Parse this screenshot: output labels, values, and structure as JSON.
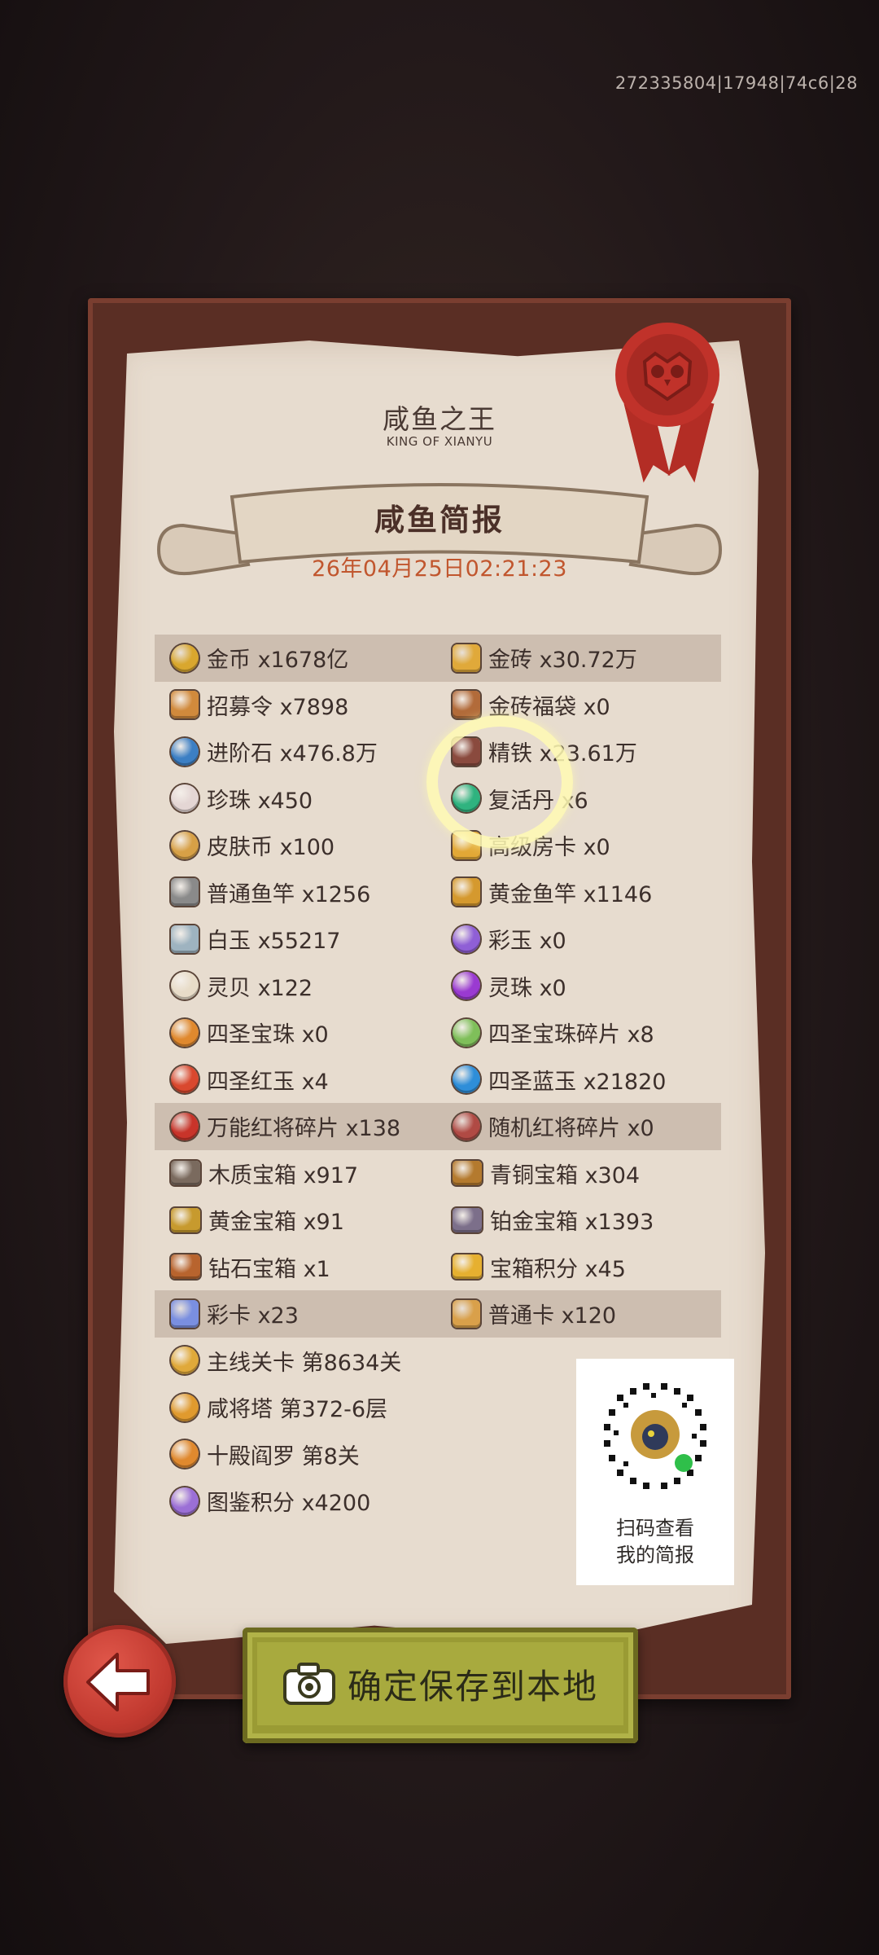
{
  "corner_id": "272335804|17948|74c6|28",
  "header": {
    "title": "咸鱼之王",
    "subtitle": "KING OF XIANYU"
  },
  "report": {
    "title": "咸鱼简报",
    "date": "26年04月25日02:21:23"
  },
  "rows": [
    {
      "shaded": true,
      "left": {
        "icon": "gold-coin-icon",
        "color": "#d9a72e",
        "text": "金币 x1678亿"
      },
      "right": {
        "icon": "gold-brick-icon",
        "color": "#e0a93a",
        "text": "金砖 x30.72万"
      }
    },
    {
      "shaded": false,
      "left": {
        "icon": "recruit-token-icon",
        "color": "#d18a3c",
        "text": "招募令 x7898"
      },
      "right": {
        "icon": "gold-brick-bag-icon",
        "color": "#b26b3a",
        "text": "金砖福袋 x0"
      }
    },
    {
      "shaded": false,
      "left": {
        "icon": "advance-stone-icon",
        "color": "#3c7fc4",
        "text": "进阶石 x476.8万"
      },
      "right": {
        "icon": "refined-iron-icon",
        "color": "#8a4a3e",
        "text": "精铁 x23.61万"
      }
    },
    {
      "shaded": false,
      "left": {
        "icon": "pearl-icon",
        "color": "#e4d6d4",
        "text": "珍珠 x450"
      },
      "right": {
        "icon": "revive-pill-icon",
        "color": "#2fb37f",
        "text": "复活丹 x6"
      }
    },
    {
      "shaded": false,
      "left": {
        "icon": "skin-coin-icon",
        "color": "#d7a046",
        "text": "皮肤币 x100"
      },
      "right": {
        "icon": "premium-room-card-icon",
        "color": "#e2a836",
        "text": "高级房卡 x0"
      }
    },
    {
      "shaded": false,
      "left": {
        "icon": "fishing-rod-icon",
        "color": "#8a8a8a",
        "text": "普通鱼竿 x1256"
      },
      "right": {
        "icon": "golden-fishing-rod-icon",
        "color": "#d5992e",
        "text": "黄金鱼竿 x1146"
      }
    },
    {
      "shaded": false,
      "left": {
        "icon": "white-jade-icon",
        "color": "#9eb3c0",
        "text": "白玉 x55217"
      },
      "right": {
        "icon": "color-jade-icon",
        "color": "#8f5fd6",
        "text": "彩玉 x0"
      }
    },
    {
      "shaded": false,
      "left": {
        "icon": "spirit-shell-icon",
        "color": "#e8dcc8",
        "text": "灵贝 x122"
      },
      "right": {
        "icon": "spirit-orb-icon",
        "color": "#9a3ad1",
        "text": "灵珠 x0"
      }
    },
    {
      "shaded": false,
      "left": {
        "icon": "four-saint-orb-icon",
        "color": "#e0892e",
        "text": "四圣宝珠 x0"
      },
      "right": {
        "icon": "four-saint-orb-shard-icon",
        "color": "#7fbf5a",
        "text": "四圣宝珠碎片 x8"
      }
    },
    {
      "shaded": false,
      "left": {
        "icon": "four-saint-red-jade-icon",
        "color": "#d9482e",
        "text": "四圣红玉 x4"
      },
      "right": {
        "icon": "four-saint-blue-jade-icon",
        "color": "#2e8ed9",
        "text": "四圣蓝玉 x21820"
      }
    },
    {
      "shaded": true,
      "left": {
        "icon": "universal-red-shard-icon",
        "color": "#c8342a",
        "text": "万能红将碎片 x138"
      },
      "right": {
        "icon": "random-red-shard-icon",
        "color": "#b04a44",
        "text": "随机红将碎片 x0"
      }
    },
    {
      "shaded": false,
      "left": {
        "icon": "wooden-chest-icon",
        "color": "#7a6a5e",
        "text": "木质宝箱 x917"
      },
      "right": {
        "icon": "bronze-chest-icon",
        "color": "#b47a2e",
        "text": "青铜宝箱 x304"
      }
    },
    {
      "shaded": false,
      "left": {
        "icon": "gold-chest-icon",
        "color": "#c79a2e",
        "text": "黄金宝箱 x91"
      },
      "right": {
        "icon": "platinum-chest-icon",
        "color": "#7c6f8a",
        "text": "铂金宝箱 x1393"
      }
    },
    {
      "shaded": false,
      "left": {
        "icon": "diamond-chest-icon",
        "color": "#b8642e",
        "text": "钻石宝箱 x1"
      },
      "right": {
        "icon": "chest-points-icon",
        "color": "#e6b030",
        "text": "宝箱积分 x45"
      }
    },
    {
      "shaded": true,
      "left": {
        "icon": "color-card-icon",
        "color": "#7a8fe0",
        "text": "彩卡 x23"
      },
      "right": {
        "icon": "normal-card-icon",
        "color": "#d9a04a",
        "text": "普通卡 x120"
      }
    },
    {
      "shaded": false,
      "left": {
        "icon": "main-stage-icon",
        "color": "#e0a93a",
        "text": "主线关卡 第8634关"
      },
      "right": null
    },
    {
      "shaded": false,
      "left": {
        "icon": "salted-tower-icon",
        "color": "#e09a2e",
        "text": "咸将塔 第372-6层"
      },
      "right": null
    },
    {
      "shaded": false,
      "left": {
        "icon": "ten-hells-icon",
        "color": "#e0892e",
        "text": "十殿阎罗 第8关"
      },
      "right": null
    },
    {
      "shaded": false,
      "left": {
        "icon": "codex-points-icon",
        "color": "#9b6fd6",
        "text": "图鉴积分 x4200"
      },
      "right": null
    }
  ],
  "qr": {
    "line1": "扫码查看",
    "line2": "我的简报"
  },
  "buttons": {
    "save_label": "确定保存到本地"
  }
}
